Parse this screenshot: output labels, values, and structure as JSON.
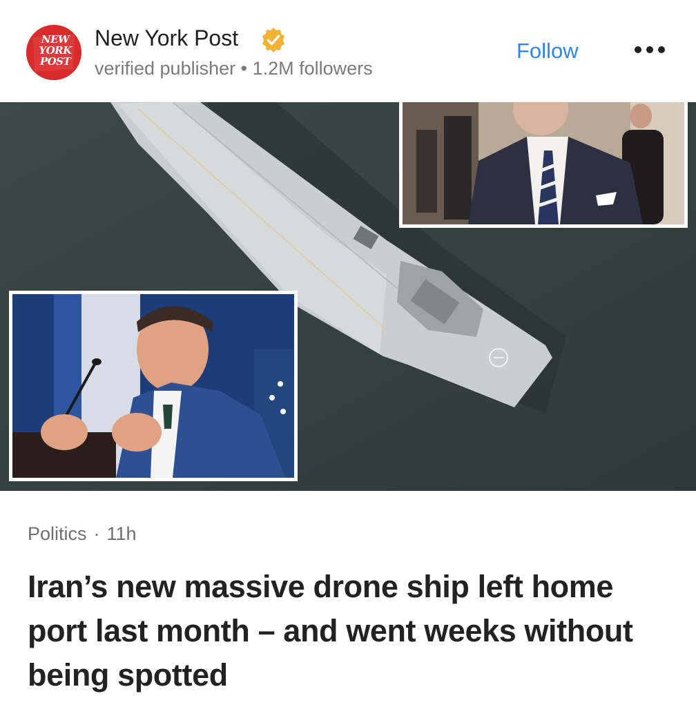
{
  "publisher": {
    "logo_text": "NEW YORK POST",
    "name": "New York Post",
    "verified_icon": "verified-badge-icon",
    "meta_label": "verified publisher",
    "separator": "•",
    "followers": "1.2M followers"
  },
  "actions": {
    "follow_label": "Follow",
    "more_icon": "more-horizontal-icon"
  },
  "article": {
    "category": "Politics",
    "separator": "·",
    "age": "11h",
    "headline": "Iran’s new massive drone ship left home port last month – and went weeks without being spotted"
  },
  "colors": {
    "accent": "#2f86e8",
    "logo_red": "#d92b2b",
    "verified_gold": "#f2b233",
    "sea": "#35413f",
    "headline_text": "#222222",
    "meta_text": "#7a7a7a"
  }
}
